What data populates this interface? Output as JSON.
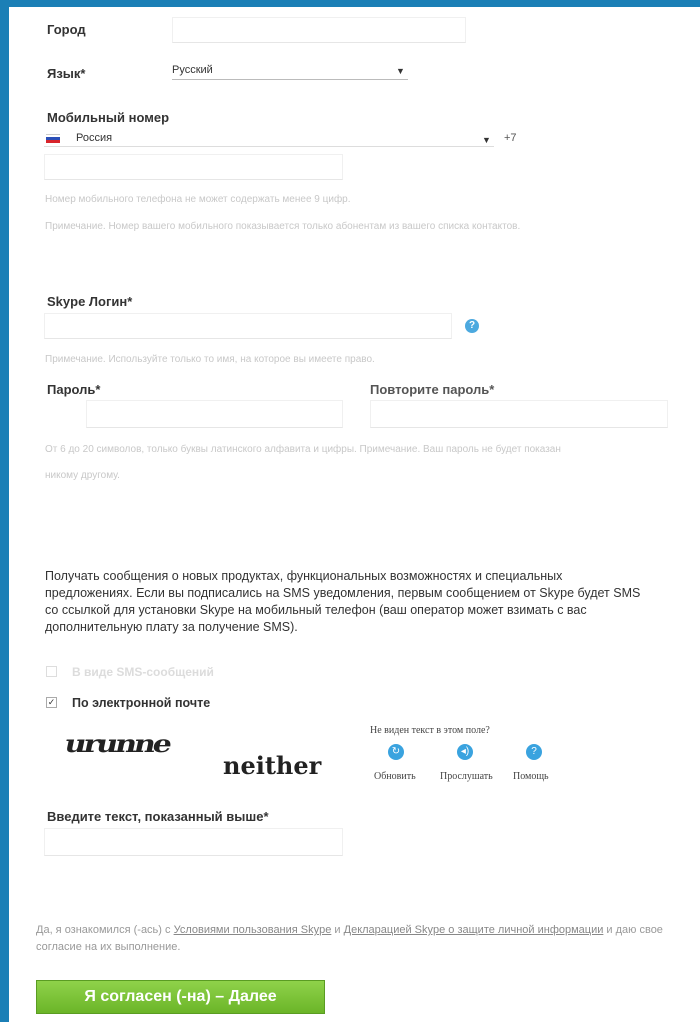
{
  "city": {
    "label": "Город",
    "value": ""
  },
  "language": {
    "label": "Язык*",
    "selected": "Русский"
  },
  "mobile": {
    "label": "Мобильный номер",
    "country": "Россия",
    "code": "+7",
    "value": "",
    "note1": "Номер мобильного телефона не может содержать менее 9 цифр.",
    "note2": "Примечание. Номер вашего мобильного показывается только абонентам из вашего списка контактов."
  },
  "skype_login": {
    "label": "Skype Логин*",
    "value": "",
    "help": "?",
    "note": "Примечание. Используйте только то имя, на которое вы имеете право."
  },
  "password": {
    "label": "Пароль*",
    "value": ""
  },
  "password_repeat": {
    "label": "Повторите пароль*",
    "value": ""
  },
  "password_note1": "От 6 до 20 символов, только буквы латинского алфавита и цифры. Примечание. Ваш пароль не будет показан",
  "password_note2": "никому другому.",
  "subscribe_text": "Получать сообщения о новых продуктах, функциональных возможностях и специальных предложениях. Если вы подписались на SMS уведомления, первым сообщением от Skype будет SMS со ссылкой для установки Skype на мобильный телефон (ваш оператор может взимать с вас дополнительную плату за получение SMS).",
  "opt_sms": {
    "label": "В виде SMS-сообщений",
    "checked": false
  },
  "opt_email": {
    "label": "По электронной почте",
    "checked": true,
    "mark": "✓"
  },
  "captcha": {
    "word1": "urunne",
    "word2": "neither",
    "cant_see": "Не виден текст в этом поле?",
    "refresh_label": "Обновить",
    "listen_label": "Прослушать",
    "help_label": "Помощь",
    "help_mark": "?"
  },
  "captcha_input": {
    "label": "Введите текст, показанный выше*",
    "value": ""
  },
  "legal": {
    "prefix": "Да, я ознакомился (-ась) с ",
    "terms": "Условиями пользования Skype",
    "and": " и ",
    "privacy": "Декларацией Skype о защите личной информации",
    "suffix": " и даю свое согласие на их выполнение."
  },
  "submit_label": "Я согласен (-на) – Далее",
  "colors": {
    "frame": "#1b7fb6",
    "button": "#7cc23a",
    "help": "#4ca9df"
  }
}
